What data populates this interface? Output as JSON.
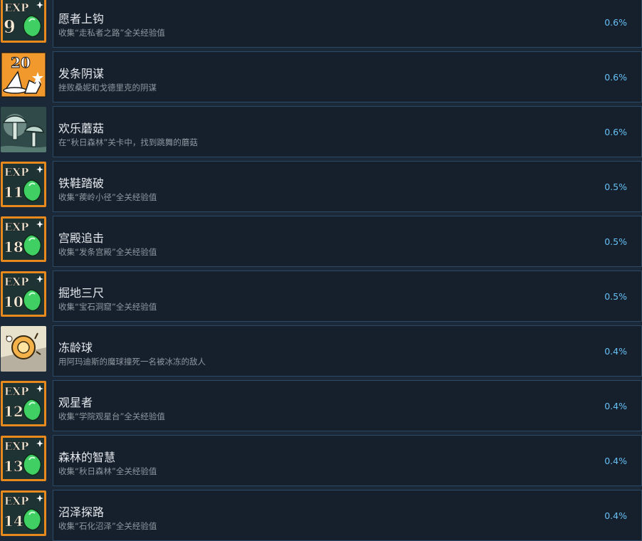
{
  "colors": {
    "background": "#1b2838",
    "panel": "#16202d",
    "panel_border": "#2c4a66",
    "title": "#e4e8ec",
    "desc": "#8f98a0",
    "percent": "#66c0f4",
    "icon_orange": "#e8891e",
    "icon_dark": "#1e3434",
    "gem_green": "#3fcf62"
  },
  "achievements": [
    {
      "title": "愿者上钩",
      "desc": "收集“走私者之路”全关经验值",
      "percent": "0.6%",
      "icon": "exp-gem-icon",
      "icon_text": "EXP",
      "icon_number": "9"
    },
    {
      "title": "发条阴谋",
      "desc": "挫败桑妮和戈德里克的阴谋",
      "percent": "0.6%",
      "icon": "twenty-wizard-hat-icon",
      "icon_text": "",
      "icon_number": "20"
    },
    {
      "title": "欢乐蘑菇",
      "desc": "在“秋日森林”关卡中，找到跳舞的蘑菇",
      "percent": "0.6%",
      "icon": "dancing-mushroom-icon",
      "icon_text": "",
      "icon_number": ""
    },
    {
      "title": "铁鞋踏破",
      "desc": "收集“蒺岭小径”全关经验值",
      "percent": "0.5%",
      "icon": "exp-gem-icon",
      "icon_text": "EXP",
      "icon_number": "11"
    },
    {
      "title": "宫殿追击",
      "desc": "收集“发条宫殿”全关经验值",
      "percent": "0.5%",
      "icon": "exp-gem-icon",
      "icon_text": "EXP",
      "icon_number": "18"
    },
    {
      "title": "掘地三尺",
      "desc": "收集“宝石洞窟”全关经验值",
      "percent": "0.5%",
      "icon": "exp-gem-icon",
      "icon_text": "EXP",
      "icon_number": "10"
    },
    {
      "title": "冻龄球",
      "desc": "用阿玛迪斯的魔球撞死一名被冰冻的敌人",
      "percent": "0.4%",
      "icon": "frozen-orb-icon",
      "icon_text": "",
      "icon_number": ""
    },
    {
      "title": "观星者",
      "desc": "收集“学院观星台”全关经验值",
      "percent": "0.4%",
      "icon": "exp-gem-icon",
      "icon_text": "EXP",
      "icon_number": "12"
    },
    {
      "title": "森林的智慧",
      "desc": "收集“秋日森林”全关经验值",
      "percent": "0.4%",
      "icon": "exp-gem-icon",
      "icon_text": "EXP",
      "icon_number": "13"
    },
    {
      "title": "沼泽探路",
      "desc": "收集“石化沼泽”全关经验值",
      "percent": "0.4%",
      "icon": "exp-gem-icon",
      "icon_text": "EXP",
      "icon_number": "14"
    }
  ]
}
